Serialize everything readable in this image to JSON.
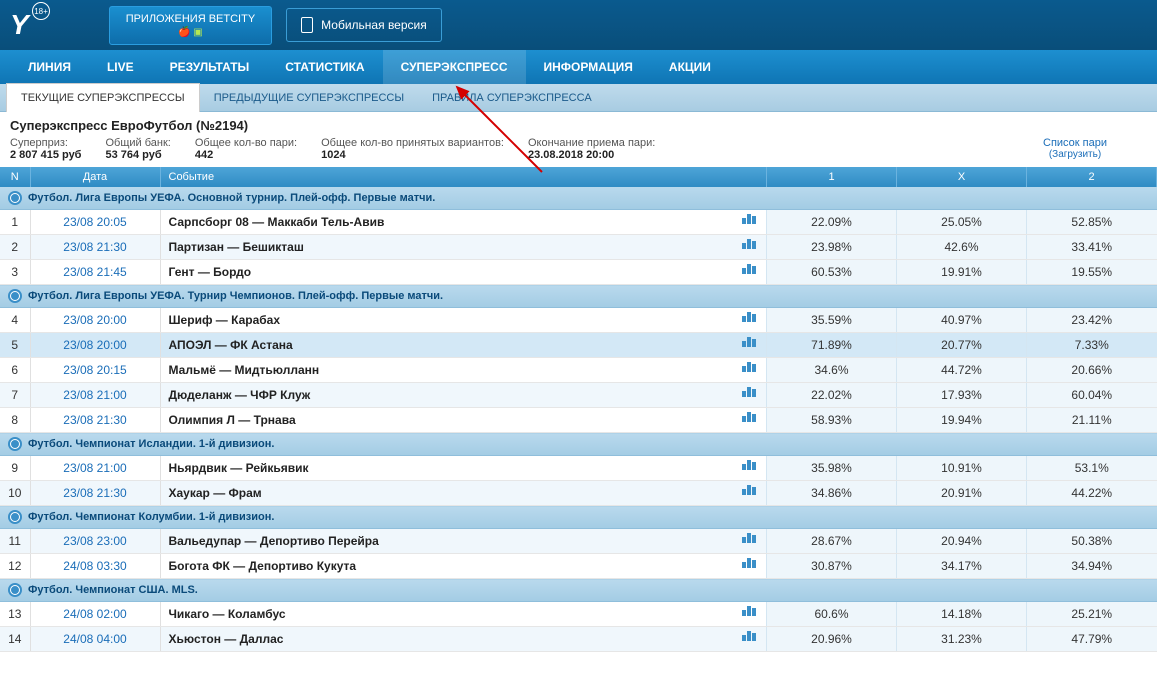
{
  "topbar": {
    "logo": "Y",
    "age": "18+",
    "appBtn": "ПРИЛОЖЕНИЯ BETCITY",
    "mobileBtn": "Мобильная версия"
  },
  "mainnav": [
    "ЛИНИЯ",
    "LIVE",
    "РЕЗУЛЬТАТЫ",
    "СТАТИСТИКА",
    "СУПЕРЭКСПРЕСС",
    "ИНФОРМАЦИЯ",
    "АКЦИИ"
  ],
  "mainnavActive": 4,
  "subnav": [
    "ТЕКУЩИЕ СУПЕРЭКСПРЕССЫ",
    "ПРЕДЫДУЩИЕ СУПЕРЭКСПРЕССЫ",
    "ПРАВИЛА СУПЕРЭКСПРЕССА"
  ],
  "subnavActive": 0,
  "title": "Суперэкспресс ЕвроФутбол (№2194)",
  "stats": {
    "s0": {
      "label": "Суперприз:",
      "value": "2 807 415 руб"
    },
    "s1": {
      "label": "Общий банк:",
      "value": "53 764 руб"
    },
    "s2": {
      "label": "Общее кол-во пари:",
      "value": "442"
    },
    "s3": {
      "label": "Общее кол-во принятых вариантов:",
      "value": "1024"
    },
    "s4": {
      "label": "Окончание приема пари:",
      "value": "23.08.2018 20:00"
    },
    "link": {
      "t1": "Список пари",
      "t2": "(Загрузить)"
    }
  },
  "thead": {
    "n": "N",
    "dt": "Дата",
    "ev": "Событие",
    "c1": "1",
    "cx": "X",
    "c2": "2"
  },
  "rows": [
    {
      "type": "group",
      "label": "Футбол. Лига Европы УЕФА. Основной турнир. Плей-офф. Первые матчи."
    },
    {
      "type": "data",
      "n": "1",
      "dt": "23/08 20:05",
      "ev": "Сарпсборг 08 — Маккаби Тель-Авив",
      "c1": "22.09%",
      "cx": "25.05%",
      "c2": "52.85%"
    },
    {
      "type": "data",
      "n": "2",
      "dt": "23/08 21:30",
      "ev": "Партизан — Бешикташ",
      "c1": "23.98%",
      "cx": "42.6%",
      "c2": "33.41%"
    },
    {
      "type": "data",
      "n": "3",
      "dt": "23/08 21:45",
      "ev": "Гент — Бордо",
      "c1": "60.53%",
      "cx": "19.91%",
      "c2": "19.55%"
    },
    {
      "type": "group",
      "label": "Футбол. Лига Европы УЕФА. Турнир Чемпионов. Плей-офф. Первые матчи."
    },
    {
      "type": "data",
      "n": "4",
      "dt": "23/08 20:00",
      "ev": "Шериф — Карабах",
      "c1": "35.59%",
      "cx": "40.97%",
      "c2": "23.42%"
    },
    {
      "type": "data",
      "n": "5",
      "dt": "23/08 20:00",
      "ev": "АПОЭЛ — ФК Астана",
      "c1": "71.89%",
      "cx": "20.77%",
      "c2": "7.33%",
      "sel": true
    },
    {
      "type": "data",
      "n": "6",
      "dt": "23/08 20:15",
      "ev": "Мальмё — Мидтьюлланн",
      "c1": "34.6%",
      "cx": "44.72%",
      "c2": "20.66%"
    },
    {
      "type": "data",
      "n": "7",
      "dt": "23/08 21:00",
      "ev": "Дюделанж — ЧФР Клуж",
      "c1": "22.02%",
      "cx": "17.93%",
      "c2": "60.04%"
    },
    {
      "type": "data",
      "n": "8",
      "dt": "23/08 21:30",
      "ev": "Олимпия Л — Трнава",
      "c1": "58.93%",
      "cx": "19.94%",
      "c2": "21.11%"
    },
    {
      "type": "group",
      "label": "Футбол. Чемпионат Исландии. 1-й дивизион."
    },
    {
      "type": "data",
      "n": "9",
      "dt": "23/08 21:00",
      "ev": "Ньярдвик — Рейкьявик",
      "c1": "35.98%",
      "cx": "10.91%",
      "c2": "53.1%"
    },
    {
      "type": "data",
      "n": "10",
      "dt": "23/08 21:30",
      "ev": "Хаукар — Фрам",
      "c1": "34.86%",
      "cx": "20.91%",
      "c2": "44.22%"
    },
    {
      "type": "group",
      "label": "Футбол. Чемпионат Колумбии. 1-й дивизион."
    },
    {
      "type": "data",
      "n": "11",
      "dt": "23/08 23:00",
      "ev": "Вальедупар — Депортиво Перейра",
      "c1": "28.67%",
      "cx": "20.94%",
      "c2": "50.38%"
    },
    {
      "type": "data",
      "n": "12",
      "dt": "24/08 03:30",
      "ev": "Богота ФК — Депортиво Кукута",
      "c1": "30.87%",
      "cx": "34.17%",
      "c2": "34.94%"
    },
    {
      "type": "group",
      "label": "Футбол. Чемпионат США. MLS."
    },
    {
      "type": "data",
      "n": "13",
      "dt": "24/08 02:00",
      "ev": "Чикаго — Коламбус",
      "c1": "60.6%",
      "cx": "14.18%",
      "c2": "25.21%"
    },
    {
      "type": "data",
      "n": "14",
      "dt": "24/08 04:00",
      "ev": "Хьюстон — Даллас",
      "c1": "20.96%",
      "cx": "31.23%",
      "c2": "47.79%"
    }
  ]
}
